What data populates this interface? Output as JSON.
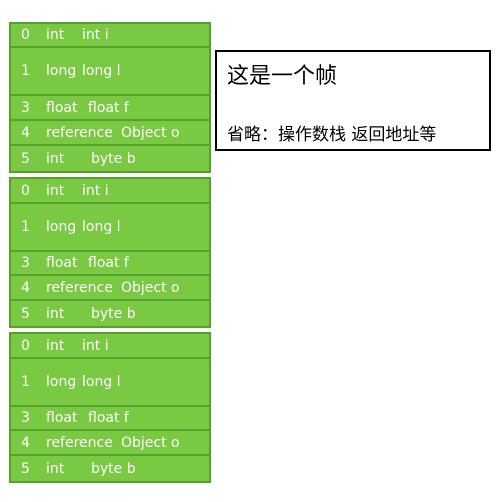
{
  "frames": [
    {
      "slots": [
        {
          "index": "0",
          "type": "int",
          "value": "int i"
        },
        {
          "index": "1",
          "type": "long",
          "value": "long l"
        },
        {
          "index": "3",
          "type": "float",
          "value": "float f"
        },
        {
          "index": "4",
          "type": "reference",
          "value": "Object o"
        },
        {
          "index": "5",
          "type": "int",
          "value": "byte b"
        }
      ]
    },
    {
      "slots": [
        {
          "index": "0",
          "type": "int",
          "value": "int i"
        },
        {
          "index": "1",
          "type": "long",
          "value": "long l"
        },
        {
          "index": "3",
          "type": "float",
          "value": "float f"
        },
        {
          "index": "4",
          "type": "reference",
          "value": "Object o"
        },
        {
          "index": "5",
          "type": "int",
          "value": "byte b"
        }
      ]
    },
    {
      "slots": [
        {
          "index": "0",
          "type": "int",
          "value": "int i"
        },
        {
          "index": "1",
          "type": "long",
          "value": "long l"
        },
        {
          "index": "3",
          "type": "float",
          "value": "float f"
        },
        {
          "index": "4",
          "type": "reference",
          "value": "Object o"
        },
        {
          "index": "5",
          "type": "int",
          "value": "byte b"
        }
      ]
    }
  ],
  "note": {
    "title": "这是一个帧",
    "subtitle": "省略：操作数栈 返回地址等"
  },
  "colors": {
    "slot_fill": "#7ac943",
    "slot_border": "#55a12b",
    "slot_text": "#ffffff"
  }
}
